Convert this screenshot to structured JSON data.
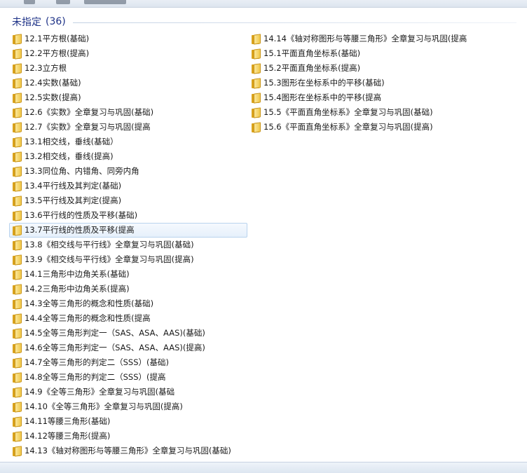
{
  "group": {
    "title": "未指定",
    "count": "(36)"
  },
  "left_items": [
    {
      "label": "12.1平方根(基础)"
    },
    {
      "label": "12.2平方根(提高)"
    },
    {
      "label": "12.3立方根"
    },
    {
      "label": "12.4实数(基础)"
    },
    {
      "label": "12.5实数(提高)"
    },
    {
      "label": "12.6《实数》全章复习与巩固(基础)"
    },
    {
      "label": "12.7《实数》全章复习与巩固(提高"
    },
    {
      "label": "13.1相交线，垂线(基础）"
    },
    {
      "label": "13.2相交线，垂线(提高)"
    },
    {
      "label": "13.3同位角、内错角、同旁内角"
    },
    {
      "label": "13.4平行线及其判定(基础)"
    },
    {
      "label": "13.5平行线及其判定(提高)"
    },
    {
      "label": "13.6平行线的性质及平移(基础)"
    },
    {
      "label": "13.7平行线的性质及平移(提高"
    },
    {
      "label": "13.8《相交线与平行线》全章复习与巩固(基础)"
    },
    {
      "label": "13.9《相交线与平行线》全章复习与巩固(提高)"
    },
    {
      "label": "14.1三角形中边角关系(基础)"
    },
    {
      "label": "14.2三角形中边角关系(提高)"
    },
    {
      "label": "14.3全等三角形的概念和性质(基础)"
    },
    {
      "label": "14.4全等三角形的概念和性质(提高"
    },
    {
      "label": "14.5全等三角形判定一（SAS、ASA、AAS)(基础)"
    },
    {
      "label": "14.6全等三角形判定一（SAS、ASA、AAS)(提高)"
    },
    {
      "label": "14.7全等三角形的判定二（SSS）(基础)"
    },
    {
      "label": "14.8全等三角形的判定二（SSS）(提高"
    },
    {
      "label": "14.9《全等三角形》全章复习与巩固(基础"
    },
    {
      "label": "14.10《全等三角形》全章复习与巩固(提高)"
    },
    {
      "label": "14.11等腰三角形(基础)"
    },
    {
      "label": "14.12等腰三角形(提高)"
    },
    {
      "label": "14.13《轴对称图形与等腰三角形》全章复习与巩固(基础)"
    }
  ],
  "right_items": [
    {
      "label": "14.14《轴对称图形与等腰三角形》全章复习与巩固(提高"
    },
    {
      "label": "15.1平面直角坐标系(基础)"
    },
    {
      "label": "15.2平面直角坐标系(提高)"
    },
    {
      "label": "15.3图形在坐标系中的平移(基础)"
    },
    {
      "label": "15.4图形在坐标系中的平移(提高"
    },
    {
      "label": "15.5《平面直角坐标系》全章复习与巩固(基础)"
    },
    {
      "label": "15.6《平面直角坐标系》全章复习与巩固(提高)"
    }
  ],
  "icon": "folder-icon",
  "hover_index": 13,
  "colors": {
    "group_title": "#1e3287",
    "hover_border": "#b9d3ee",
    "folder": "#f1c84a"
  }
}
